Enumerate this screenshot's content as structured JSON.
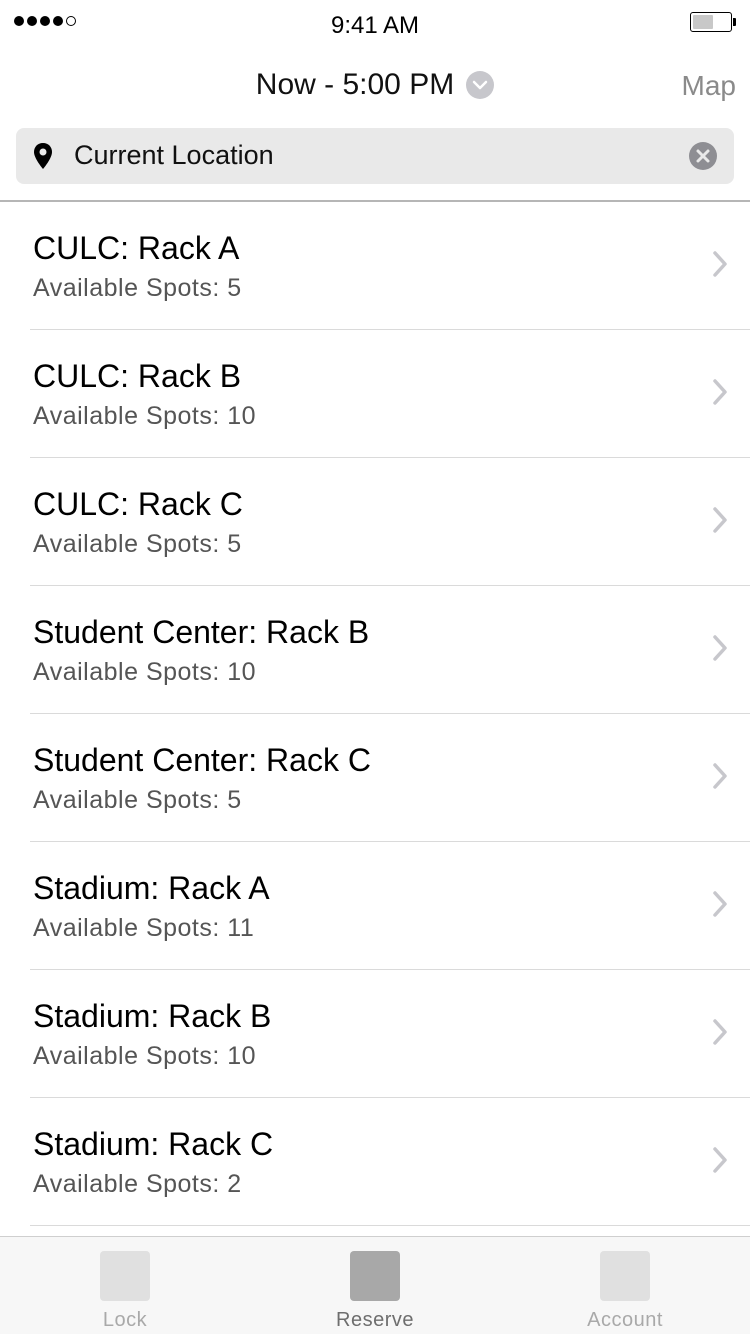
{
  "status_bar": {
    "time": "9:41 AM",
    "signal_bars_filled": 4,
    "signal_bars_total": 5
  },
  "nav": {
    "time_range": "Now - 5:00 PM",
    "map_label": "Map"
  },
  "search": {
    "value": "Current Location"
  },
  "racks": [
    {
      "name": "CULC: Rack A",
      "spots": "Available Spots: 5"
    },
    {
      "name": "CULC: Rack B",
      "spots": "Available Spots: 10"
    },
    {
      "name": "CULC: Rack C",
      "spots": "Available Spots: 5"
    },
    {
      "name": "Student Center: Rack B",
      "spots": "Available Spots: 10"
    },
    {
      "name": "Student Center: Rack C",
      "spots": "Available Spots: 5"
    },
    {
      "name": "Stadium: Rack A",
      "spots": "Available Spots: 11"
    },
    {
      "name": "Stadium: Rack B",
      "spots": "Available Spots: 10"
    },
    {
      "name": "Stadium: Rack C",
      "spots": "Available Spots: 2"
    }
  ],
  "tabs": [
    {
      "label": "Lock"
    },
    {
      "label": "Reserve"
    },
    {
      "label": "Account"
    }
  ],
  "active_tab": "Reserve",
  "colors": {
    "search_bg": "#e9e9e9",
    "secondary_text": "#555555",
    "chevron": "#c7c7cc",
    "tab_active": "#6e6e6e",
    "tab_inactive": "#a9a9a9"
  }
}
